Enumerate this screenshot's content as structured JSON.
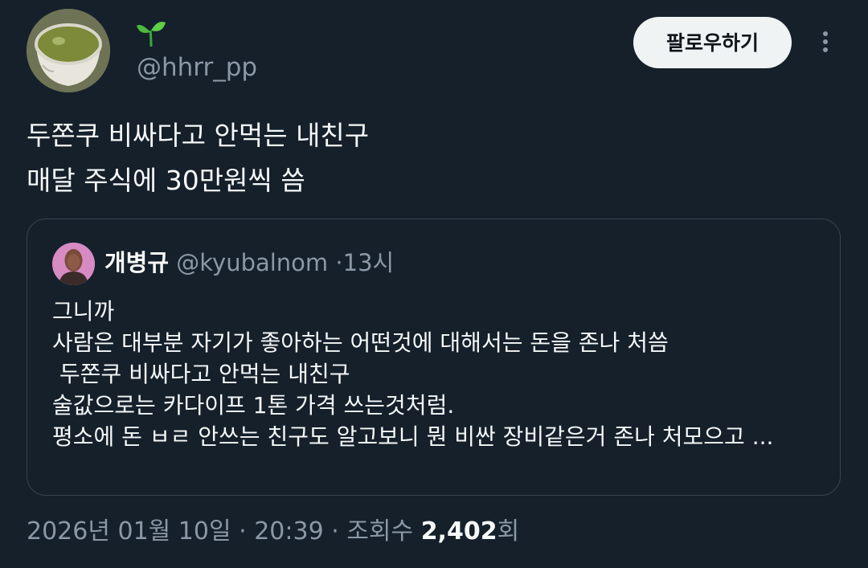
{
  "author": {
    "avatar_icon": "tea-cup-avatar",
    "display_name_emoji": "sprout-icon",
    "handle": "@hhrr_pp"
  },
  "actions": {
    "follow_label": "팔로우하기",
    "more_icon": "vertical-ellipsis-icon"
  },
  "tweet": {
    "lines": [
      "두쫀쿠 비싸다고 안먹는 내친구",
      "매달 주식에 30만원씩 씀"
    ]
  },
  "quote": {
    "name": "개병규",
    "handle": "@kyubalnom",
    "separator": "·",
    "time": "13시",
    "lines": [
      "그니까",
      "사람은 대부분 자기가 좋아하는 어떤것에 대해서는 돈을 존나 처씀",
      " 두쫀쿠 비싸다고 안먹는 내친구",
      "술값으로는 카다이프 1톤 가격 쓰는것처럼.",
      "평소에 돈 ㅂㄹ 안쓰는 친구도 알고보니 뭔 비싼 장비같은거 존나 처모으고 ..."
    ]
  },
  "meta": {
    "date": "2026년 01월 10일",
    "sep1": "·",
    "time": "20:39",
    "sep2": "·",
    "views_label": "조회수",
    "views_count": "2,402",
    "views_suffix": "회"
  },
  "colors": {
    "background": "#15202b",
    "text": "#f7f9f9",
    "secondary": "#8b98a5",
    "border": "#38444d",
    "button_bg": "#eff3f4"
  }
}
